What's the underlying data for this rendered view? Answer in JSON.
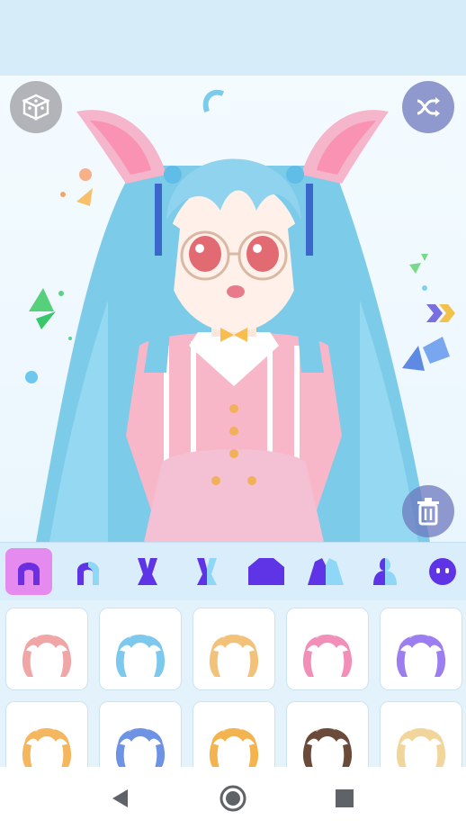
{
  "app": {
    "accent": "#8a5cf6",
    "highlight": "#e58bf0",
    "bg": "#d6ecf9"
  },
  "icons": {
    "random_left": "dice-icon",
    "random_right": "shuffle-icon",
    "delete": "trash-icon",
    "next": "double-chevron-right-icon"
  },
  "categories": [
    {
      "name": "back-hair",
      "selected": true
    },
    {
      "name": "front-hair",
      "selected": false
    },
    {
      "name": "animal-ears",
      "selected": false
    },
    {
      "name": "ears-alt",
      "selected": false
    },
    {
      "name": "top",
      "selected": false
    },
    {
      "name": "outfit",
      "selected": false
    },
    {
      "name": "half-body",
      "selected": false
    },
    {
      "name": "face",
      "selected": false
    }
  ],
  "hair_items": [
    {
      "color": "#f0a6a6"
    },
    {
      "color": "#7dc9ee"
    },
    {
      "color": "#f2c27a"
    },
    {
      "color": "#f28fb8"
    },
    {
      "color": "#9c7ef0"
    },
    {
      "color": "#f4b75e"
    },
    {
      "color": "#6f93e4"
    },
    {
      "color": "#f3b44f"
    },
    {
      "color": "#6b4a3a"
    },
    {
      "color": "#f1d59a"
    }
  ],
  "navbar": [
    "back-nav-icon",
    "home-nav-icon",
    "recents-nav-icon"
  ]
}
